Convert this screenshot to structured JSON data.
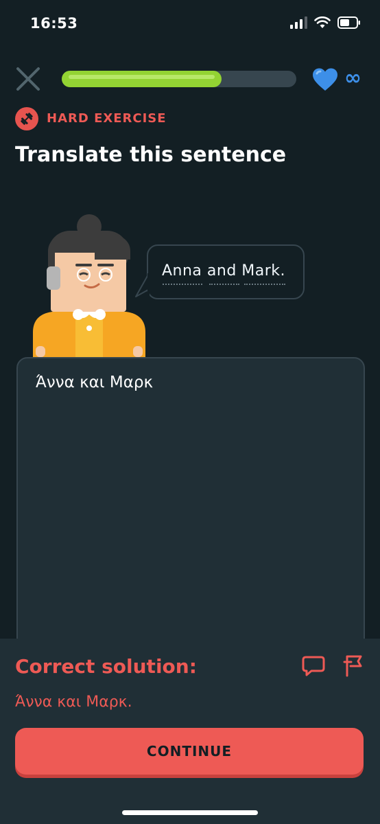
{
  "status_bar": {
    "time": "16:53"
  },
  "progress": {
    "fraction": 0.68
  },
  "lives": {
    "label": "∞"
  },
  "exercise": {
    "badge": "HARD EXERCISE",
    "title": "Translate this sentence"
  },
  "prompt": {
    "sentence": "Anna and Mark."
  },
  "answer": {
    "value": "Άννα και Μαρκ"
  },
  "feedback": {
    "heading": "Correct solution:",
    "solution": "Άννα και Μαρκ.",
    "continue_label": "CONTINUE"
  },
  "colors": {
    "accent_red": "#ee5a55",
    "progress_green": "#93d333",
    "heart_blue": "#3d8fe8",
    "background": "#131f24"
  },
  "icons": [
    "close-icon",
    "heart-icon",
    "infinity-icon",
    "dumbbell-icon",
    "comment-icon",
    "flag-icon"
  ]
}
